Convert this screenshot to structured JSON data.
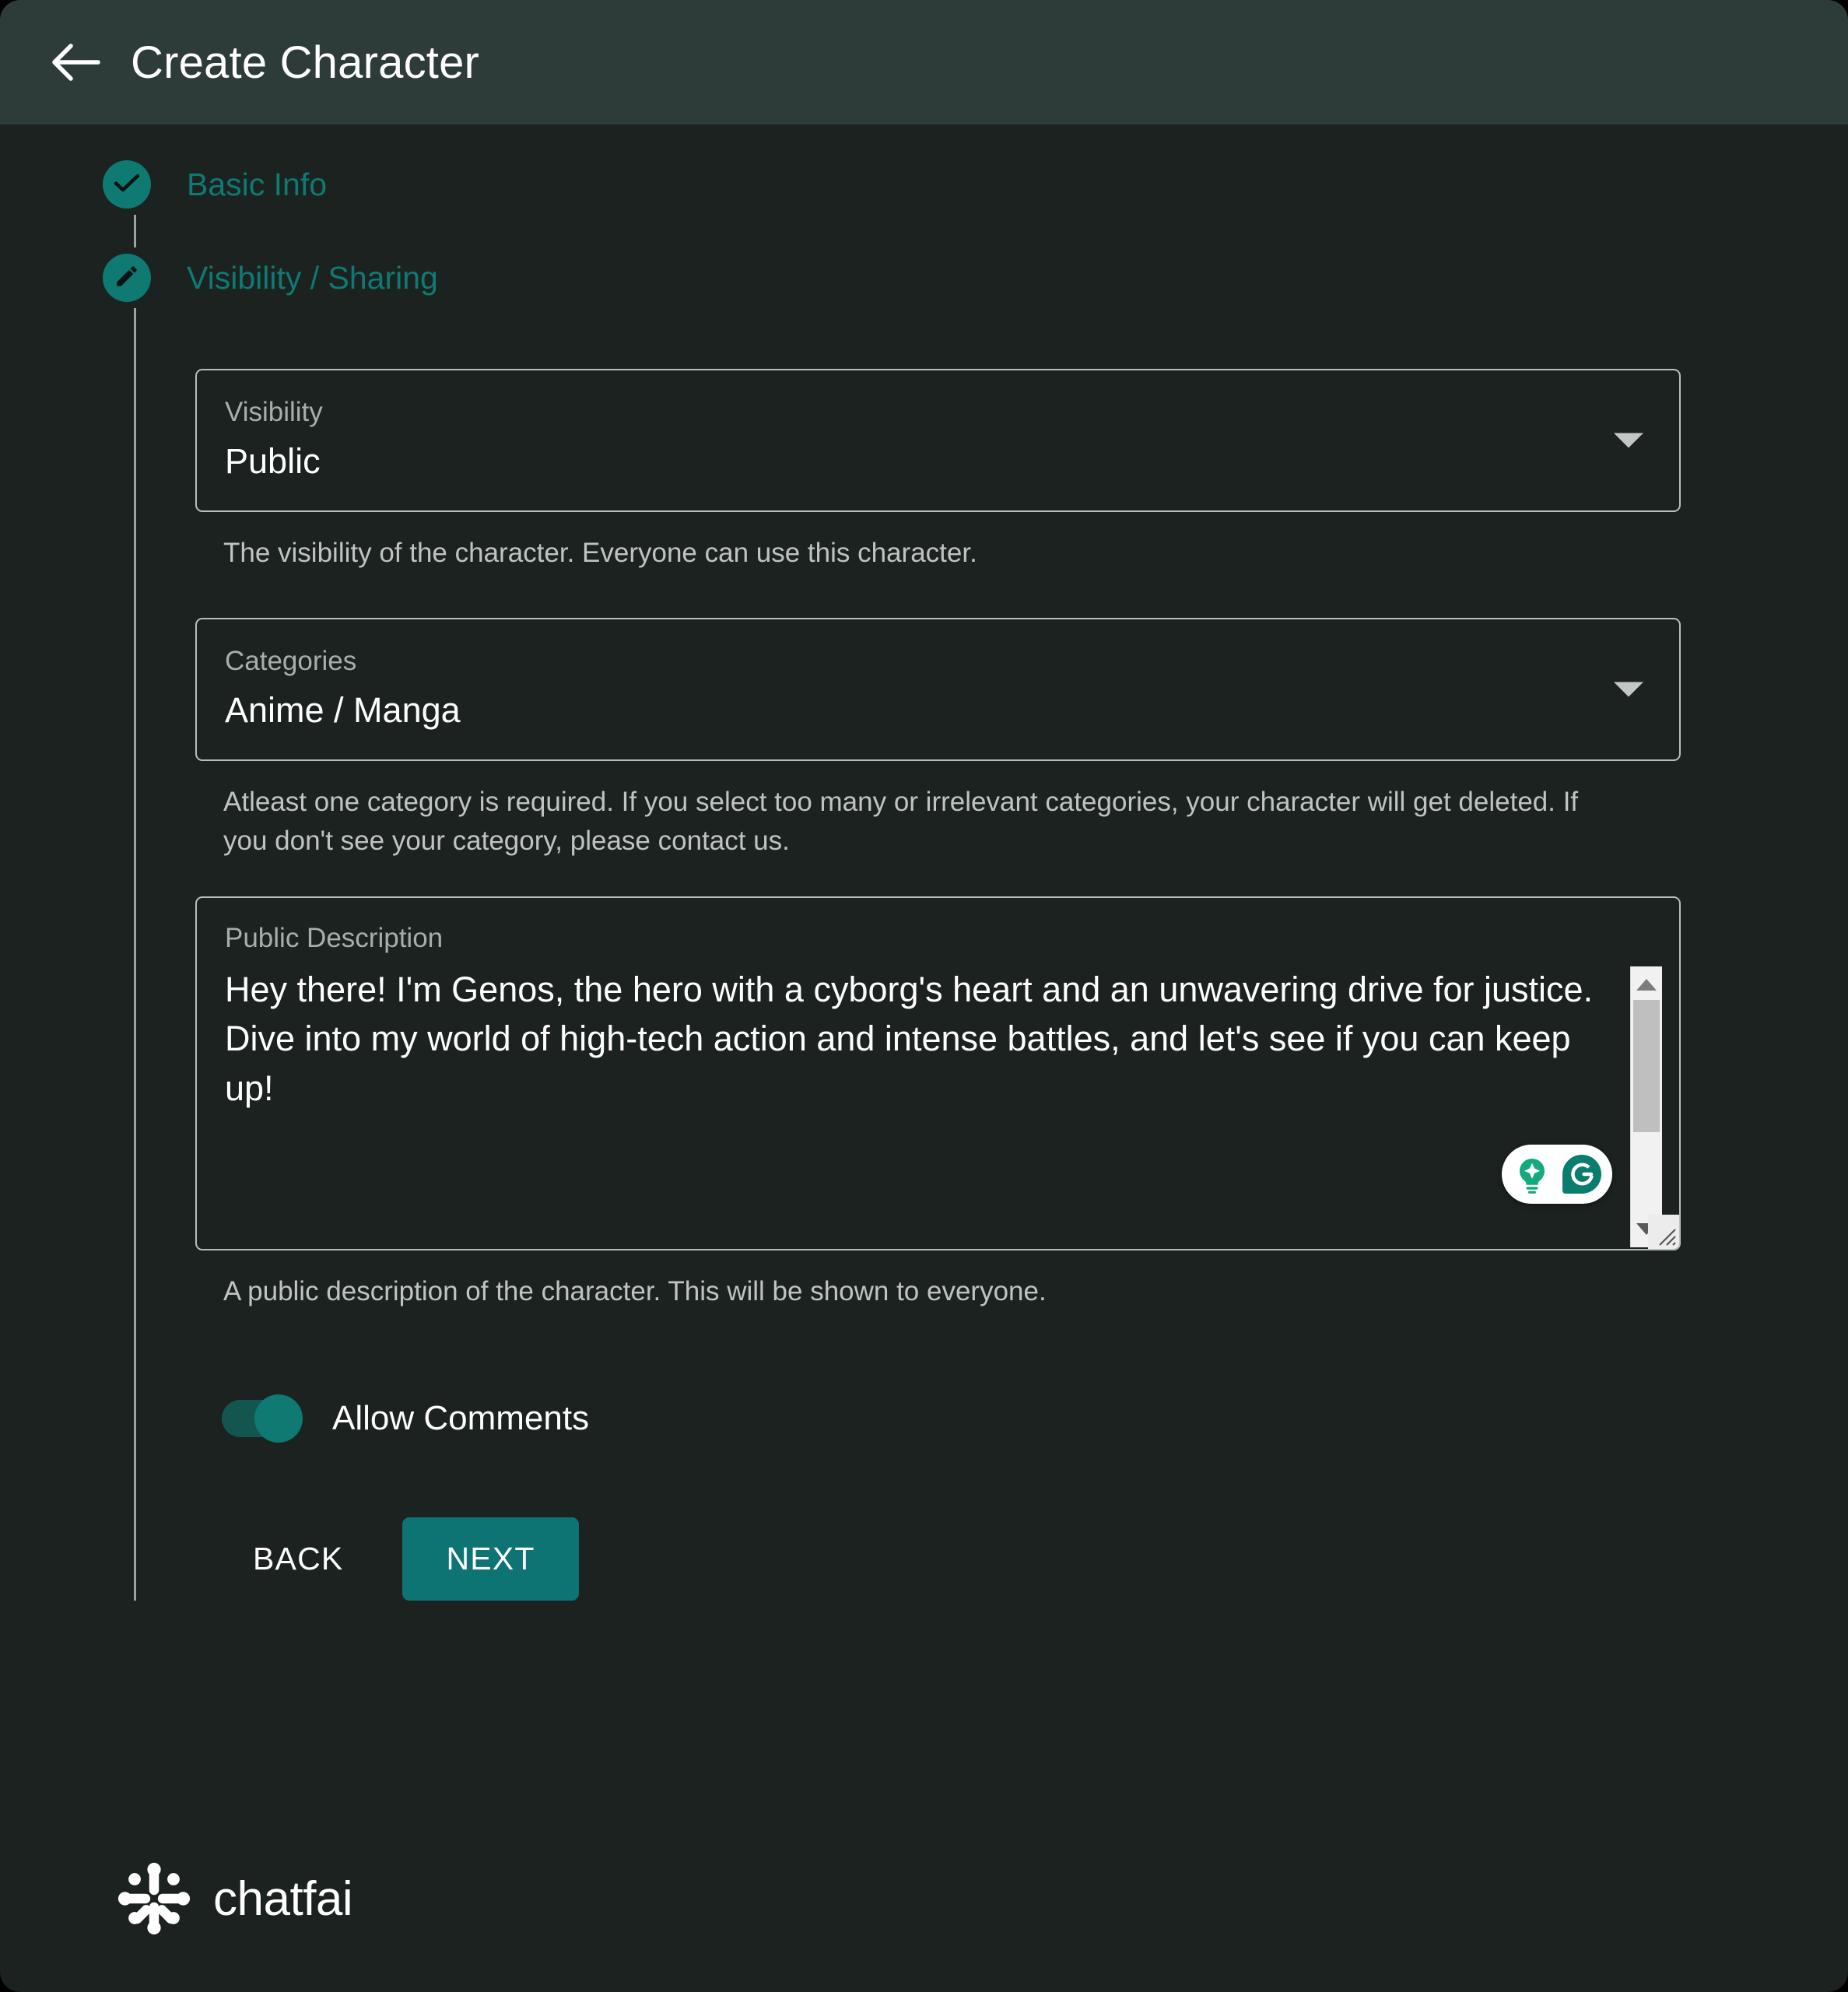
{
  "theme": {
    "background": "#1B2220",
    "header_background": "#2D3B39",
    "accent": "#0E7373",
    "step_accent": "#0E7A72",
    "step_label_color": "#0F7A72",
    "border": "#B9BEBC",
    "text": "#FFFFFF",
    "muted_text": "#A8AEAC"
  },
  "header": {
    "title": "Create Character",
    "back_icon": "arrow-left-icon"
  },
  "stepper": {
    "steps": [
      {
        "label": "Basic Info",
        "icon": "check-icon",
        "state": "completed"
      },
      {
        "label": "Visibility / Sharing",
        "icon": "pencil-icon",
        "state": "active"
      }
    ]
  },
  "form": {
    "visibility": {
      "label": "Visibility",
      "value": "Public",
      "helper": "The visibility of the character. Everyone can use this character.",
      "caret_icon": "chevron-down-icon"
    },
    "categories": {
      "label": "Categories",
      "value": "Anime / Manga",
      "helper": "Atleast one category is required. If you select too many or irrelevant categories, your character will get deleted. If you don't see your category, please contact us.",
      "caret_icon": "chevron-down-icon"
    },
    "public_description": {
      "label": "Public Description",
      "value": "Hey there! I'm Genos, the hero with a cyborg's heart and an unwavering drive for justice. Dive into my world of high-tech action and intense battles, and let's see if you can keep up!",
      "helper": "A public description of the character. This will be shown to everyone.",
      "scrollbar": {
        "up_icon": "scroll-up-arrow-icon",
        "down_icon": "scroll-down-arrow-icon",
        "resize_icon": "resize-grip-icon"
      },
      "grammarly_badge": {
        "name": "grammarly-assistant-badge",
        "icons": [
          "lightbulb-icon",
          "grammarly-g-icon"
        ]
      }
    },
    "allow_comments": {
      "label": "Allow Comments",
      "state": "on"
    }
  },
  "actions": {
    "back_label": "BACK",
    "next_label": "NEXT"
  },
  "footer": {
    "brand": "chatfai",
    "logo_icon": "chatfai-logo-icon"
  }
}
